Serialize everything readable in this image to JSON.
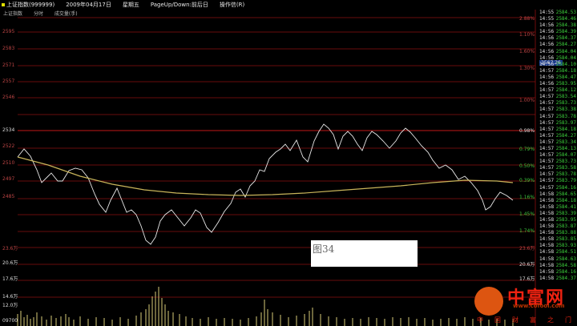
{
  "header": {
    "title": "上证指数(999999)",
    "date": "2009年04月17日",
    "weekday": "星期五",
    "hint": "PageUp/Down:前后日",
    "mode": "操作信(R)"
  },
  "subtitle": {
    "index_name": "上证指数",
    "tab_time": "分时",
    "tab_volume": "成交量(手)"
  },
  "price_axis_left": [
    "2595",
    "2583",
    "2571",
    "2557",
    "2546",
    "2534",
    "2522",
    "2510",
    "2497",
    "2485"
  ],
  "pct_axis_right": [
    "2.88%",
    "1.10%",
    "1.60%",
    "1.30%",
    "1.00%",
    "0.98%",
    "0.79%",
    "0.50%",
    "0.39%",
    "1.16%",
    "1.45%",
    "1.74%"
  ],
  "volume_axis": [
    "23.6万",
    "20.6万",
    "17.6万",
    "14.6万",
    "12.0万",
    "09700"
  ],
  "price_tag": "2567.26",
  "tick_list": [
    {
      "time": "14:55",
      "price": "2584.53"
    },
    {
      "time": "14:55",
      "price": "2584.46"
    },
    {
      "time": "14:56",
      "price": "2584.38"
    },
    {
      "time": "14:56",
      "price": "2584.39"
    },
    {
      "time": "14:56",
      "price": "2584.37"
    },
    {
      "time": "14:56",
      "price": "2584.27"
    },
    {
      "time": "14:56",
      "price": "2584.04"
    },
    {
      "time": "14:56",
      "price": "2584.04"
    },
    {
      "time": "14:56",
      "price": "2584.10"
    },
    {
      "time": "14:57",
      "price": "2584.18"
    },
    {
      "time": "14:56",
      "price": "2584.47"
    },
    {
      "time": "14:56",
      "price": "2583.95"
    },
    {
      "time": "14:57",
      "price": "2584.12"
    },
    {
      "time": "14:57",
      "price": "2583.54"
    },
    {
      "time": "14:57",
      "price": "2583.73"
    },
    {
      "time": "14:57",
      "price": "2583.38"
    },
    {
      "time": "14:57",
      "price": "2583.78"
    },
    {
      "time": "14:57",
      "price": "2583.97"
    },
    {
      "time": "14:57",
      "price": "2584.18"
    },
    {
      "time": "14:57",
      "price": "2584.27"
    },
    {
      "time": "14:57",
      "price": "2583.34"
    },
    {
      "time": "14:57",
      "price": "2584.13"
    },
    {
      "time": "14:57",
      "price": "2584.07"
    },
    {
      "time": "14:57",
      "price": "2583.73"
    },
    {
      "time": "14:57",
      "price": "2583.58"
    },
    {
      "time": "14:57",
      "price": "2583.78"
    },
    {
      "time": "14:57",
      "price": "2583.79"
    },
    {
      "time": "14:57",
      "price": "2584.16"
    },
    {
      "time": "14:58",
      "price": "2584.65"
    },
    {
      "time": "14:58",
      "price": "2584.18"
    },
    {
      "time": "14:58",
      "price": "2584.41"
    },
    {
      "time": "14:58",
      "price": "2583.39"
    },
    {
      "time": "14:58",
      "price": "2583.95"
    },
    {
      "time": "14:58",
      "price": "2583.87"
    },
    {
      "time": "14:58",
      "price": "2583.88"
    },
    {
      "time": "14:58",
      "price": "2583.85"
    },
    {
      "time": "14:58",
      "price": "2583.93"
    },
    {
      "time": "14:58",
      "price": "2584.51"
    },
    {
      "time": "14:58",
      "price": "2584.63"
    },
    {
      "time": "14:58",
      "price": "2584.58"
    },
    {
      "time": "14:58",
      "price": "2584.16"
    },
    {
      "time": "14:58",
      "price": "2584.37"
    }
  ],
  "figure_label": "图34",
  "watermark": {
    "name": "中富网",
    "url": "www.cofool.com",
    "slogan": [
      "中",
      "国",
      "财",
      "富",
      "之",
      "门"
    ]
  },
  "colors": {
    "background": "#000000",
    "grid": "#8b1010",
    "price_line": "#e8e8e8",
    "avg_line": "#c8b45a",
    "volume": "#d8cc78",
    "up": "#3cd33c"
  }
}
